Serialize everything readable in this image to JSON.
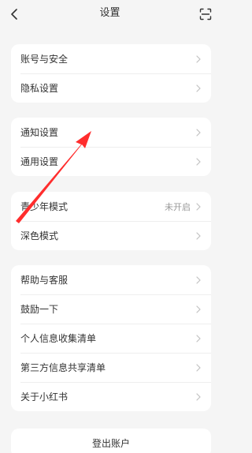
{
  "header": {
    "title": "设置",
    "back_icon": "chevron-left-icon",
    "scan_icon": "scan-icon"
  },
  "groups": [
    {
      "items": [
        {
          "label": "账号与安全"
        },
        {
          "label": "隐私设置"
        }
      ]
    },
    {
      "items": [
        {
          "label": "通知设置"
        },
        {
          "label": "通用设置"
        }
      ]
    },
    {
      "items": [
        {
          "label": "青少年模式",
          "value": "未开启"
        },
        {
          "label": "深色模式"
        }
      ]
    },
    {
      "items": [
        {
          "label": "帮助与客服"
        },
        {
          "label": "鼓励一下"
        },
        {
          "label": "个人信息收集清单"
        },
        {
          "label": "第三方信息共享清单"
        },
        {
          "label": "关于小红书"
        }
      ]
    }
  ],
  "logout": {
    "label": "登出账户"
  },
  "annotation": {
    "color": "#ff2d2d",
    "icon": "red-arrow"
  },
  "colors": {
    "background": "#f5f5f5",
    "card": "#ffffff",
    "text": "#333333",
    "secondary_text": "#999999",
    "chevron": "#c2c2c2"
  }
}
